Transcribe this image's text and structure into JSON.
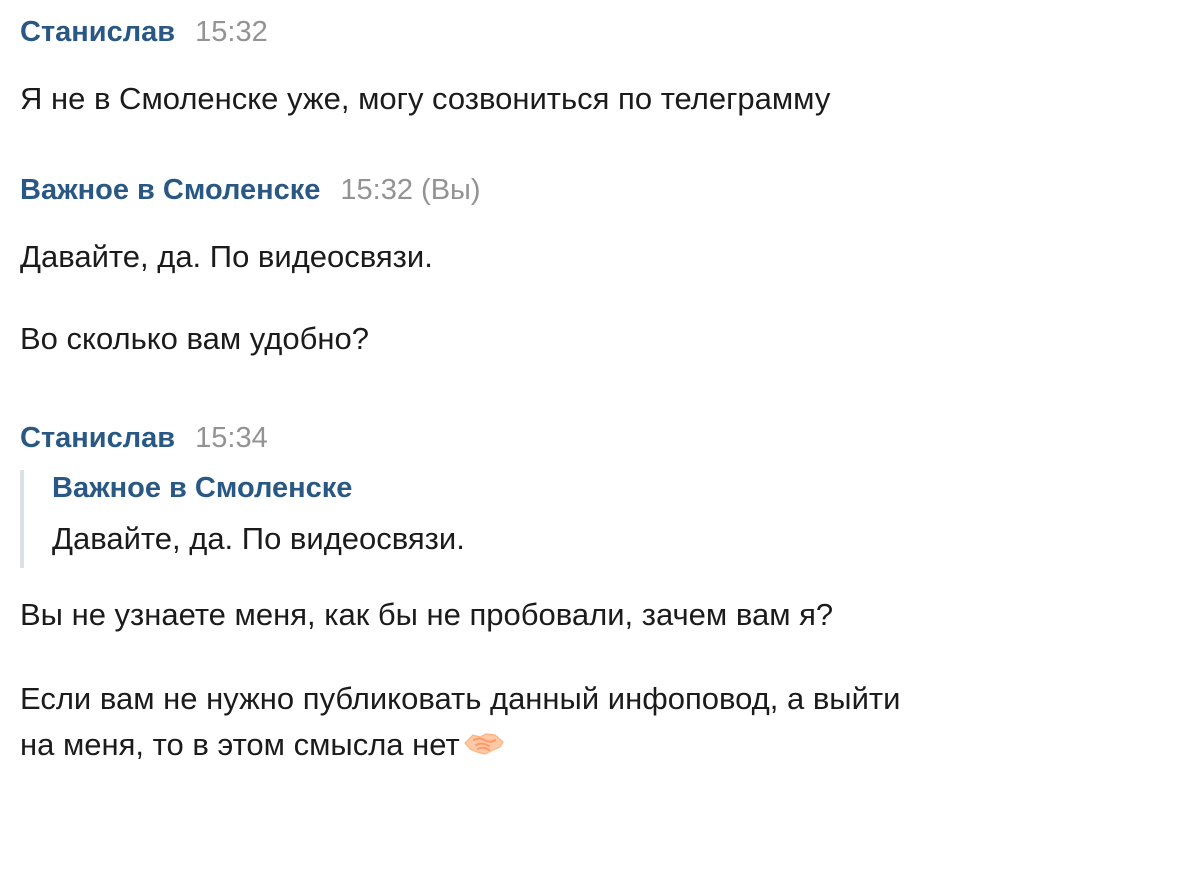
{
  "messages": [
    {
      "author": "Станислав",
      "time": "15:32",
      "lines": [
        "Я не в Смоленске уже, могу созвониться по телеграмму"
      ]
    },
    {
      "author": "Важное в Смоленске",
      "time": "15:32",
      "you_label": "(Вы)",
      "lines": [
        "Давайте, да. По видеосвязи.",
        "Во сколько вам удобно?"
      ]
    },
    {
      "author": "Станислав",
      "time": "15:34",
      "quote": {
        "author": "Важное в Смоленске",
        "text": "Давайте, да. По видеосвязи."
      },
      "lines": [
        "Вы не узнаете меня, как бы не пробовали, зачем вам я?",
        "Если вам не нужно публиковать данный инфоповод, а выйти",
        "на меня, то в этом смысла нет"
      ],
      "emoji": "handshake-icon"
    }
  ],
  "colors": {
    "author": "#2a5885",
    "time": "#939393",
    "text": "#1b1b1b",
    "quote_bar": "#dce1e6"
  }
}
